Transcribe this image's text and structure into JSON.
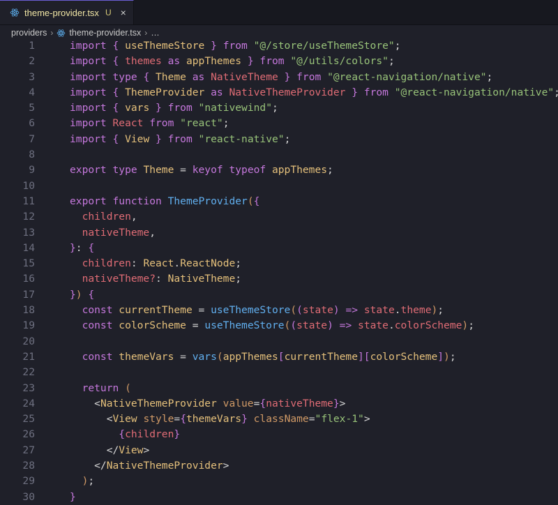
{
  "tab": {
    "title": "theme-provider.tsx",
    "status": "U",
    "close": "×",
    "icon": "react-icon"
  },
  "breadcrumb": {
    "folder": "providers",
    "file": "theme-provider.tsx",
    "more": "…"
  },
  "code": [
    {
      "n": "1",
      "t": [
        [
          "import",
          "kw"
        ],
        [
          " ",
          "p"
        ],
        [
          "{",
          "brace"
        ],
        [
          " useThemeStore ",
          "id"
        ],
        [
          "}",
          "brace"
        ],
        [
          " from ",
          "kw"
        ],
        [
          "\"@/store/useThemeStore\"",
          "str"
        ],
        [
          ";",
          "punc"
        ]
      ]
    },
    {
      "n": "2",
      "t": [
        [
          "import",
          "kw"
        ],
        [
          " ",
          "p"
        ],
        [
          "{",
          "brace"
        ],
        [
          " themes ",
          "param"
        ],
        [
          "as",
          "kw"
        ],
        [
          " appThemes ",
          "id"
        ],
        [
          "}",
          "brace"
        ],
        [
          " from ",
          "kw"
        ],
        [
          "\"@/utils/colors\"",
          "str"
        ],
        [
          ";",
          "punc"
        ]
      ]
    },
    {
      "n": "3",
      "t": [
        [
          "import",
          "kw"
        ],
        [
          " type ",
          "kw"
        ],
        [
          "{",
          "brace"
        ],
        [
          " Theme ",
          "id"
        ],
        [
          "as",
          "kw"
        ],
        [
          " NativeTheme ",
          "param"
        ],
        [
          "}",
          "brace"
        ],
        [
          " from ",
          "kw"
        ],
        [
          "\"@react-navigation/native\"",
          "str"
        ],
        [
          ";",
          "punc"
        ]
      ]
    },
    {
      "n": "4",
      "t": [
        [
          "import",
          "kw"
        ],
        [
          " ",
          "p"
        ],
        [
          "{",
          "brace"
        ],
        [
          " ThemeProvider ",
          "id"
        ],
        [
          "as",
          "kw"
        ],
        [
          " NativeThemeProvider ",
          "param"
        ],
        [
          "}",
          "brace"
        ],
        [
          " from ",
          "kw"
        ],
        [
          "\"@react-navigation/native\"",
          "str"
        ],
        [
          ";",
          "punc"
        ]
      ]
    },
    {
      "n": "5",
      "t": [
        [
          "import",
          "kw"
        ],
        [
          " ",
          "p"
        ],
        [
          "{",
          "brace"
        ],
        [
          " vars ",
          "id"
        ],
        [
          "}",
          "brace"
        ],
        [
          " from ",
          "kw"
        ],
        [
          "\"nativewind\"",
          "str"
        ],
        [
          ";",
          "punc"
        ]
      ]
    },
    {
      "n": "6",
      "t": [
        [
          "import",
          "kw"
        ],
        [
          " React ",
          "param"
        ],
        [
          "from ",
          "kw"
        ],
        [
          "\"react\"",
          "str"
        ],
        [
          ";",
          "punc"
        ]
      ]
    },
    {
      "n": "7",
      "t": [
        [
          "import",
          "kw"
        ],
        [
          " ",
          "p"
        ],
        [
          "{",
          "brace"
        ],
        [
          " View ",
          "id"
        ],
        [
          "}",
          "brace"
        ],
        [
          " from ",
          "kw"
        ],
        [
          "\"react-native\"",
          "str"
        ],
        [
          ";",
          "punc"
        ]
      ]
    },
    {
      "n": "8",
      "t": []
    },
    {
      "n": "9",
      "t": [
        [
          "export",
          "kw"
        ],
        [
          " type ",
          "kw"
        ],
        [
          "Theme",
          "id"
        ],
        [
          " = ",
          "punc"
        ],
        [
          "keyof",
          "kw"
        ],
        [
          " typeof ",
          "kw"
        ],
        [
          "appThemes",
          "id"
        ],
        [
          ";",
          "punc"
        ]
      ]
    },
    {
      "n": "10",
      "t": []
    },
    {
      "n": "11",
      "t": [
        [
          "export",
          "kw"
        ],
        [
          " function ",
          "kw"
        ],
        [
          "ThemeProvider",
          "fn"
        ],
        [
          "(",
          "paren"
        ],
        [
          "{",
          "brace"
        ]
      ]
    },
    {
      "n": "12",
      "t": [
        [
          "  children",
          "param"
        ],
        [
          ",",
          "punc"
        ]
      ]
    },
    {
      "n": "13",
      "t": [
        [
          "  nativeTheme",
          "param"
        ],
        [
          ",",
          "punc"
        ]
      ]
    },
    {
      "n": "14",
      "t": [
        [
          "}",
          "brace"
        ],
        [
          ": ",
          "punc"
        ],
        [
          "{",
          "brace"
        ]
      ]
    },
    {
      "n": "15",
      "t": [
        [
          "  children",
          "param"
        ],
        [
          ": ",
          "punc"
        ],
        [
          "React",
          "id"
        ],
        [
          ".",
          "punc"
        ],
        [
          "ReactNode",
          "id"
        ],
        [
          ";",
          "punc"
        ]
      ]
    },
    {
      "n": "16",
      "t": [
        [
          "  nativeTheme?",
          "param"
        ],
        [
          ": ",
          "punc"
        ],
        [
          "NativeTheme",
          "id"
        ],
        [
          ";",
          "punc"
        ]
      ]
    },
    {
      "n": "17",
      "t": [
        [
          "}",
          "brace"
        ],
        [
          ")",
          "paren"
        ],
        [
          " ",
          "p"
        ],
        [
          "{",
          "brace"
        ]
      ]
    },
    {
      "n": "18",
      "t": [
        [
          "  const ",
          "kw"
        ],
        [
          "currentTheme",
          "id"
        ],
        [
          " = ",
          "punc"
        ],
        [
          "useThemeStore",
          "fn"
        ],
        [
          "(",
          "paren"
        ],
        [
          "(",
          "brace"
        ],
        [
          "state",
          "param"
        ],
        [
          ")",
          "brace"
        ],
        [
          " => ",
          "kw"
        ],
        [
          "state",
          "param"
        ],
        [
          ".",
          "punc"
        ],
        [
          "theme",
          "param"
        ],
        [
          ")",
          "paren"
        ],
        [
          ";",
          "punc"
        ]
      ]
    },
    {
      "n": "19",
      "t": [
        [
          "  const ",
          "kw"
        ],
        [
          "colorScheme",
          "id"
        ],
        [
          " = ",
          "punc"
        ],
        [
          "useThemeStore",
          "fn"
        ],
        [
          "(",
          "paren"
        ],
        [
          "(",
          "brace"
        ],
        [
          "state",
          "param"
        ],
        [
          ")",
          "brace"
        ],
        [
          " => ",
          "kw"
        ],
        [
          "state",
          "param"
        ],
        [
          ".",
          "punc"
        ],
        [
          "colorScheme",
          "param"
        ],
        [
          ")",
          "paren"
        ],
        [
          ";",
          "punc"
        ]
      ]
    },
    {
      "n": "20",
      "t": []
    },
    {
      "n": "21",
      "t": [
        [
          "  const ",
          "kw"
        ],
        [
          "themeVars",
          "id"
        ],
        [
          " = ",
          "punc"
        ],
        [
          "vars",
          "fn"
        ],
        [
          "(",
          "paren"
        ],
        [
          "appThemes",
          "id"
        ],
        [
          "[",
          "brace"
        ],
        [
          "currentTheme",
          "id"
        ],
        [
          "]",
          "brace"
        ],
        [
          "[",
          "brace"
        ],
        [
          "colorScheme",
          "id"
        ],
        [
          "]",
          "brace"
        ],
        [
          ")",
          "paren"
        ],
        [
          ";",
          "punc"
        ]
      ]
    },
    {
      "n": "22",
      "t": []
    },
    {
      "n": "23",
      "t": [
        [
          "  return ",
          "kw"
        ],
        [
          "(",
          "paren"
        ]
      ]
    },
    {
      "n": "24",
      "t": [
        [
          "    <",
          "punc"
        ],
        [
          "NativeThemeProvider",
          "tag"
        ],
        [
          " value",
          "attr"
        ],
        [
          "=",
          "punc"
        ],
        [
          "{",
          "brace"
        ],
        [
          "nativeTheme",
          "param"
        ],
        [
          "}",
          "brace"
        ],
        [
          ">",
          "punc"
        ]
      ]
    },
    {
      "n": "25",
      "t": [
        [
          "      <",
          "punc"
        ],
        [
          "View",
          "tag"
        ],
        [
          " style",
          "attr"
        ],
        [
          "=",
          "punc"
        ],
        [
          "{",
          "brace"
        ],
        [
          "themeVars",
          "id"
        ],
        [
          "}",
          "brace"
        ],
        [
          " className",
          "attr"
        ],
        [
          "=",
          "punc"
        ],
        [
          "\"flex-1\"",
          "str"
        ],
        [
          ">",
          "punc"
        ]
      ]
    },
    {
      "n": "26",
      "t": [
        [
          "        ",
          "p"
        ],
        [
          "{",
          "brace"
        ],
        [
          "children",
          "param"
        ],
        [
          "}",
          "brace"
        ]
      ]
    },
    {
      "n": "27",
      "t": [
        [
          "      </",
          "punc"
        ],
        [
          "View",
          "tag"
        ],
        [
          ">",
          "punc"
        ]
      ]
    },
    {
      "n": "28",
      "t": [
        [
          "    </",
          "punc"
        ],
        [
          "NativeThemeProvider",
          "tag"
        ],
        [
          ">",
          "punc"
        ]
      ]
    },
    {
      "n": "29",
      "t": [
        [
          "  ",
          "p"
        ],
        [
          ")",
          "paren"
        ],
        [
          ";",
          "punc"
        ]
      ]
    },
    {
      "n": "30",
      "t": [
        [
          "}",
          "brace"
        ]
      ]
    }
  ]
}
